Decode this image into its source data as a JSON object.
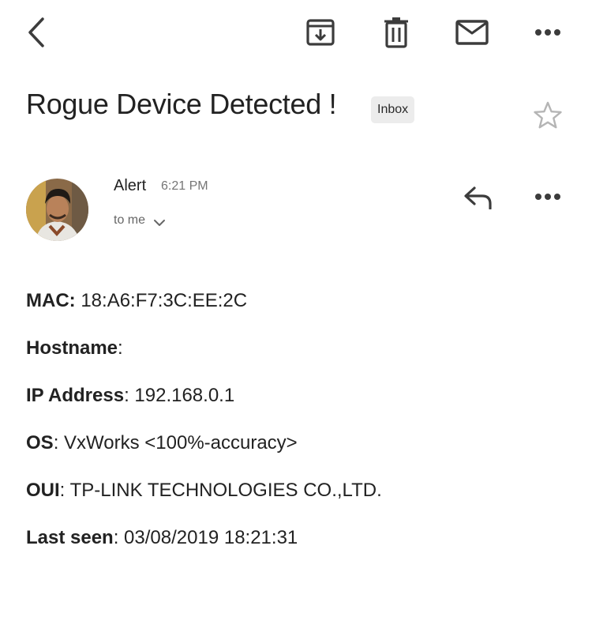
{
  "toolbar": {
    "icons": [
      "back-arrow-icon",
      "archive-icon",
      "trash-icon",
      "mail-icon",
      "more-dots-icon"
    ]
  },
  "subject": {
    "title": "Rogue Device Detected !",
    "label_chip": "Inbox"
  },
  "message": {
    "sender_name": "Alert",
    "time": "6:21 PM",
    "recipient": "to me",
    "fields": [
      {
        "label": "MAC:",
        "value": " 18:A6:F7:3C:EE:2C"
      },
      {
        "label": "Hostname",
        "value": ":"
      },
      {
        "label": "IP Address",
        "value": ": 192.168.0.1"
      },
      {
        "label": "OS",
        "value": ": VxWorks <100%-accuracy>"
      },
      {
        "label": "OUI",
        "value": ": TP-LINK TECHNOLOGIES CO.,LTD."
      },
      {
        "label": "Last seen",
        "value": ": 03/08/2019 18:21:31"
      }
    ]
  },
  "colors": {
    "icon": "#5f6368",
    "text": "#222222",
    "secondary_text": "#757575",
    "chip_background": "#ececec",
    "star_outline": "#b5b5b5"
  }
}
